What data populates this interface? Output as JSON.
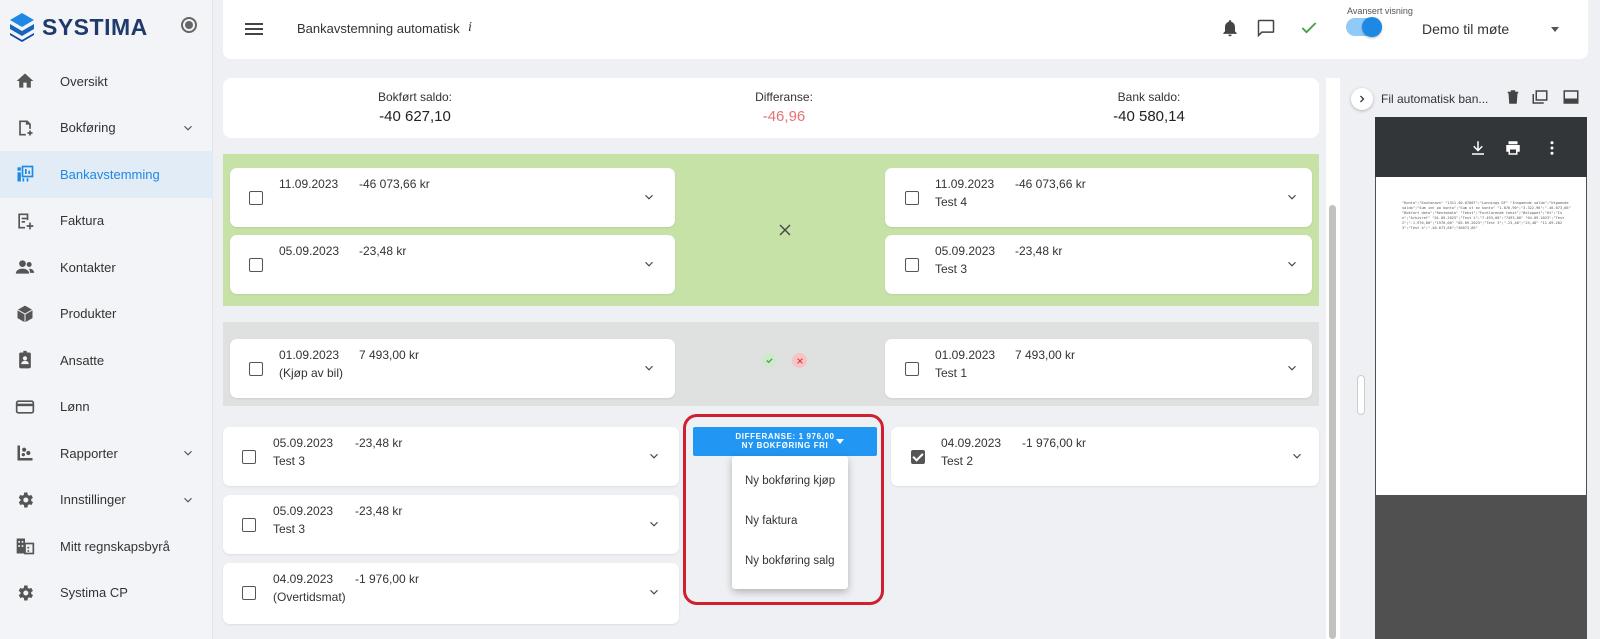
{
  "brand": {
    "name": "SYSTIMA"
  },
  "sidebar": {
    "items": [
      {
        "label": "Oversikt",
        "icon": "home-icon"
      },
      {
        "label": "Bokføring",
        "icon": "ledger-icon",
        "expandable": true
      },
      {
        "label": "Bankavstemming",
        "icon": "bank-reconciliation-icon",
        "active": true
      },
      {
        "label": "Faktura",
        "icon": "invoice-icon"
      },
      {
        "label": "Kontakter",
        "icon": "contacts-icon"
      },
      {
        "label": "Produkter",
        "icon": "product-box-icon"
      },
      {
        "label": "Ansatte",
        "icon": "employee-badge-icon"
      },
      {
        "label": "Lønn",
        "icon": "credit-card-icon"
      },
      {
        "label": "Rapporter",
        "icon": "reports-icon",
        "expandable": true
      },
      {
        "label": "Innstillinger",
        "icon": "gear-icon",
        "expandable": true
      },
      {
        "label": "Mitt regnskapsbyrå",
        "icon": "office-building-icon"
      },
      {
        "label": "Systima CP",
        "icon": "gear-icon"
      }
    ]
  },
  "topbar": {
    "title": "Bankavstemning automatisk",
    "info": "i",
    "advanced_label": "Avansert visning",
    "advanced_on": true,
    "company": "Demo til møte"
  },
  "saldo": {
    "booked_label": "Bokført saldo:",
    "booked_value": "-40 627,10",
    "diff_label": "Differanse:",
    "diff_value": "-46,96",
    "bank_label": "Bank saldo:",
    "bank_value": "-40 580,14"
  },
  "groups": {
    "green": {
      "left": [
        {
          "date": "11.09.2023",
          "amount": "-46 073,66 kr",
          "desc": ""
        },
        {
          "date": "05.09.2023",
          "amount": "-23,48 kr",
          "desc": ""
        }
      ],
      "right": [
        {
          "date": "11.09.2023",
          "amount": "-46 073,66 kr",
          "desc": "Test 4"
        },
        {
          "date": "05.09.2023",
          "amount": "-23,48 kr",
          "desc": "Test 3"
        }
      ]
    },
    "grey": {
      "left": [
        {
          "date": "01.09.2023",
          "amount": "7 493,00 kr",
          "desc": "(Kjøp av bil)"
        }
      ],
      "right": [
        {
          "date": "01.09.2023",
          "amount": "7 493,00 kr",
          "desc": "Test 1"
        }
      ]
    },
    "open": {
      "left": [
        {
          "date": "05.09.2023",
          "amount": "-23,48 kr",
          "desc": "Test 3"
        },
        {
          "date": "05.09.2023",
          "amount": "-23,48 kr",
          "desc": "Test 3"
        },
        {
          "date": "04.09.2023",
          "amount": "-1 976,00 kr",
          "desc": "(Overtidsmat)"
        }
      ],
      "right": [
        {
          "date": "04.09.2023",
          "amount": "-1 976,00 kr",
          "desc": "Test 2",
          "checked": true
        }
      ]
    }
  },
  "diff_button": {
    "line1": "DIFFERANSE: 1 976,00",
    "line2": "NY BOKFØRING FRI"
  },
  "dropdown": {
    "items": [
      "Ny bokføring kjøp",
      "Ny faktura",
      "Ny bokføring salg"
    ]
  },
  "panel": {
    "title": "Fil automatisk ban..."
  },
  "pdf": {
    "text": "\"Konto\";\"Kontonavn\" \"1311.50.07607\";\"Lonnings DF\" \"Inngaende saldo\";\"Utgaende saldo\";\"Sum inn pa konto\";\"Sum ut av konto\" \"1.076,90\";\"3.322,96\";\"-46.073,66\" \"Bokfort dato\";\"Rentedato\" \"Tekst\";\"Forklarende tekst\";\"Beloppet\";\"Ut\";\"Inn\";\"Arkivref\" \"01.09.2023\";\"Test 1\";\"7.493,00\";\"7493,00\" \"04.09.2023\";\"Test 2\";\"-1.976,00\";\"1976,00\" \"05.09.2023\";\"Test 3\";\"-23,48\";\"23,48\" \"11.09.2023\";\"Test 4\";\"-46.073,66\";\"46073,66\""
  }
}
